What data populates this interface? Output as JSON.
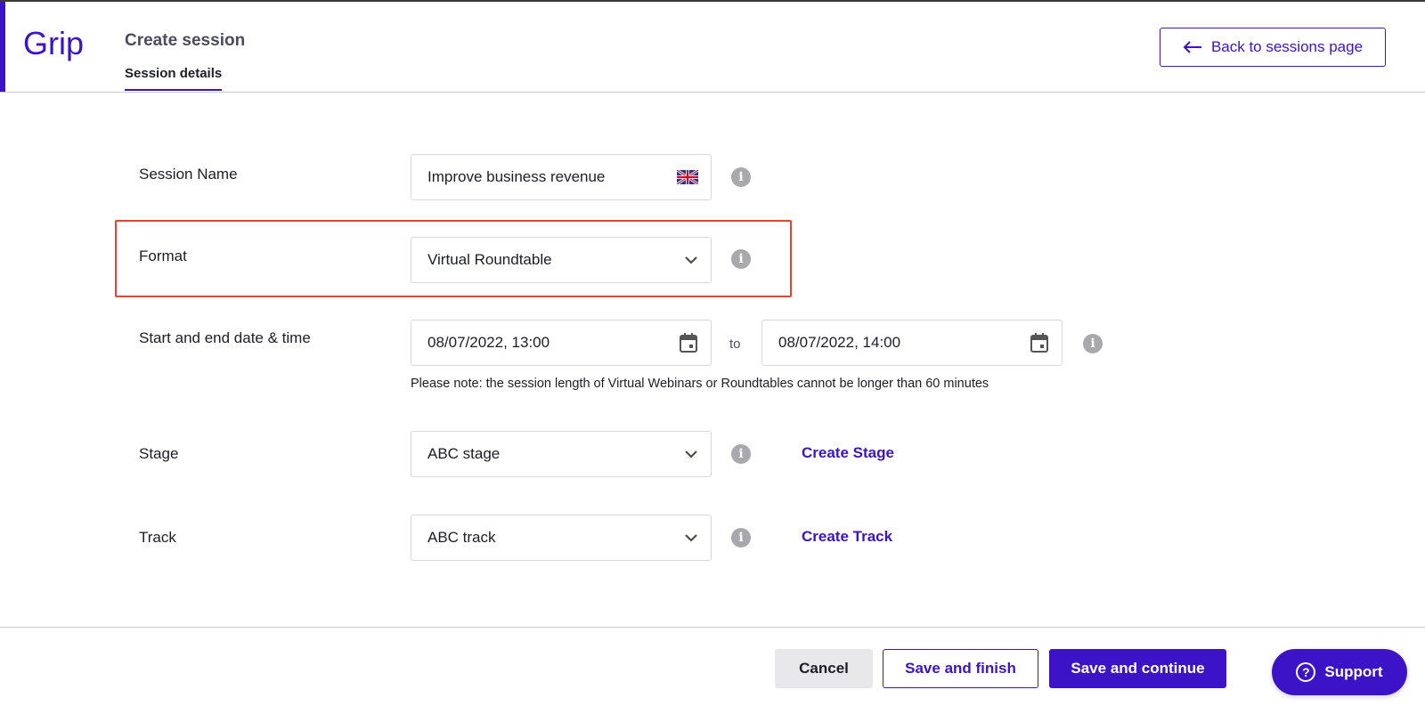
{
  "header": {
    "logo_text": "Grip",
    "title": "Create session",
    "tab": "Session details",
    "back_button": "Back to sessions page"
  },
  "form": {
    "session_name": {
      "label": "Session Name",
      "value": "Improve business revenue",
      "flag_icon": "uk-flag-icon"
    },
    "format": {
      "label": "Format",
      "value": "Virtual Roundtable"
    },
    "datetime": {
      "label": "Start and end date & time",
      "start": "08/07/2022, 13:00",
      "separator": "to",
      "end": "08/07/2022, 14:00",
      "note": "Please note: the session length of Virtual Webinars or Roundtables cannot be longer than 60 minutes"
    },
    "stage": {
      "label": "Stage",
      "value": "ABC stage",
      "create_link": "Create Stage"
    },
    "track": {
      "label": "Track",
      "value": "ABC track",
      "create_link": "Create Track"
    }
  },
  "footer": {
    "cancel": "Cancel",
    "save_finish": "Save and finish",
    "save_continue": "Save and continue"
  },
  "support": {
    "label": "Support"
  },
  "colors": {
    "brand": "#3d13c8",
    "highlight": "#e8412c",
    "info_icon": "#a9a9ad"
  }
}
